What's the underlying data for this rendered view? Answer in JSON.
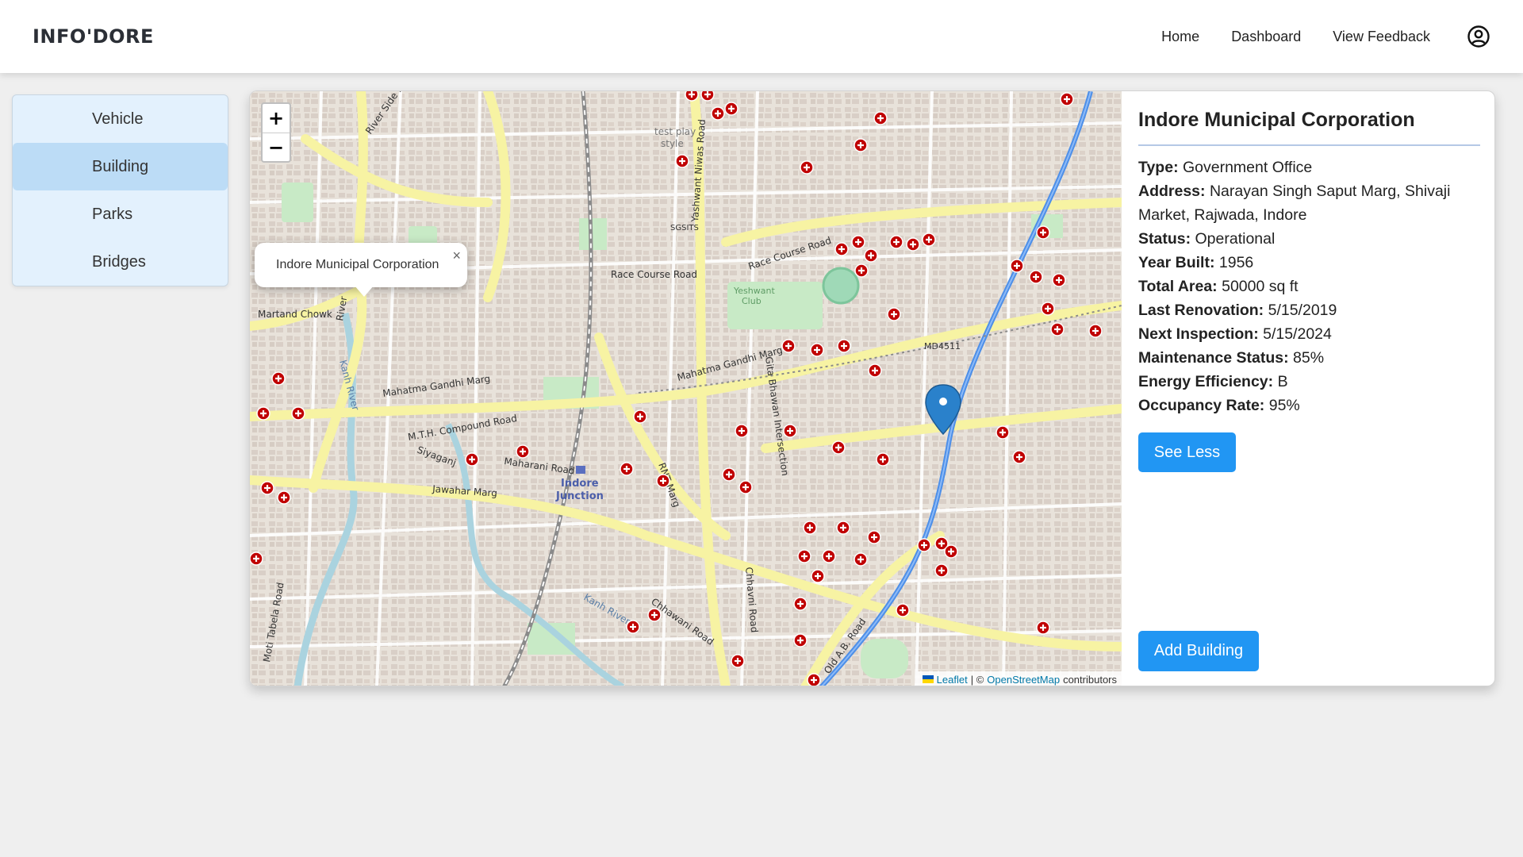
{
  "header": {
    "brand": "INFO'DORE",
    "nav": [
      "Home",
      "Dashboard",
      "View Feedback"
    ],
    "profile_icon": "user-circle-icon"
  },
  "sidebar": {
    "items": [
      {
        "label": "Vehicle",
        "active": false
      },
      {
        "label": "Building",
        "active": true
      },
      {
        "label": "Parks",
        "active": false
      },
      {
        "label": "Bridges",
        "active": false
      }
    ]
  },
  "map": {
    "zoom_in": "+",
    "zoom_out": "−",
    "popup": {
      "text": "Indore Municipal Corporation",
      "close": "×"
    },
    "attribution": {
      "leaflet": "Leaflet",
      "sep": "| ©",
      "osm": "OpenStreetMap",
      "suffix": "contributors"
    },
    "labels": [
      "River Side Road",
      "Martand Chowk",
      "River",
      "Mahatma Gandhi Marg",
      "M.T.H. Compound Road",
      "Maharani Road",
      "Jawahar Marg",
      "Indore Junction",
      "Race Course Road",
      "Yeshwant Club",
      "Yashwant Niwas Road",
      "RNT Marg",
      "Gita Bhawan Intersection",
      "Chhavni Road",
      "Old A.B. Road",
      "MD4511",
      "Kanh River",
      "SGSITS",
      "test play style",
      "Chhawani Road",
      "Moti Tabela Road",
      "Siyaganj"
    ],
    "marker_color": "#c00000",
    "pin_color": "#2a81cb"
  },
  "info": {
    "title": "Indore Municipal Corporation",
    "fields": [
      {
        "label": "Type:",
        "value": "Government Office"
      },
      {
        "label": "Address:",
        "value": "Narayan Singh Saput Marg, Shivaji Market, Rajwada, Indore"
      },
      {
        "label": "Status:",
        "value": "Operational"
      },
      {
        "label": "Year Built:",
        "value": "1956"
      },
      {
        "label": "Total Area:",
        "value": "50000 sq ft"
      },
      {
        "label": "Last Renovation:",
        "value": "5/15/2019"
      },
      {
        "label": "Next Inspection:",
        "value": "5/15/2024"
      },
      {
        "label": "Maintenance Status:",
        "value": "85%"
      },
      {
        "label": "Energy Efficiency:",
        "value": "B"
      },
      {
        "label": "Occupancy Rate:",
        "value": "95%"
      }
    ],
    "see_less": "See Less",
    "add_building": "Add Building"
  },
  "colors": {
    "accent": "#2196f3",
    "sidebar_bg": "#e3f1fd",
    "sidebar_active": "#bcdcf6"
  }
}
